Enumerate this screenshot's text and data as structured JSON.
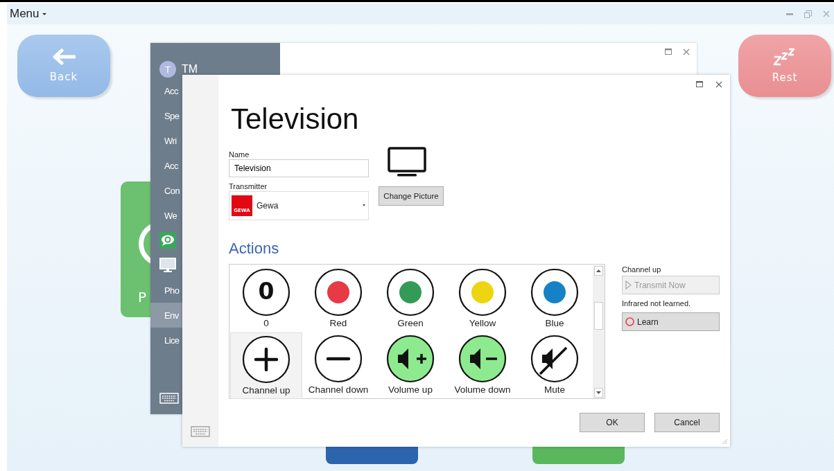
{
  "menu": {
    "label": "Menu"
  },
  "tiles": [
    {
      "label": "Back",
      "kind": "back"
    },
    {
      "label": "Rest",
      "kind": "rest"
    }
  ],
  "partial_tile": {
    "label": "P"
  },
  "settings_window": {
    "user": {
      "initial": "T",
      "name": "TM"
    },
    "items": [
      {
        "kind": "text",
        "label": "Acc",
        "selected": false
      },
      {
        "kind": "text",
        "label": "Spe",
        "selected": false
      },
      {
        "kind": "text",
        "label": "Wri",
        "selected": false
      },
      {
        "kind": "text",
        "label": "Acc",
        "selected": false
      },
      {
        "kind": "text",
        "label": "Con",
        "selected": false
      },
      {
        "kind": "text",
        "label": "We",
        "selected": false
      },
      {
        "kind": "chat",
        "selected": false
      },
      {
        "kind": "monitor",
        "selected": false
      },
      {
        "kind": "text",
        "label": "Pho",
        "selected": false
      },
      {
        "kind": "text",
        "label": "Env",
        "selected": true
      },
      {
        "kind": "text",
        "label": "Lice",
        "selected": false
      }
    ]
  },
  "dialog": {
    "title": "Television",
    "name_label": "Name",
    "name_value": "Television",
    "transmitter_label": "Transmitter",
    "transmitter": {
      "logo": "GEWA",
      "value": "Gewa"
    },
    "change_picture": "Change Picture",
    "actions_heading": "Actions",
    "actions": [
      {
        "label": "0",
        "kind": "digit",
        "glyph": "0",
        "selected": false
      },
      {
        "label": "Red",
        "kind": "dot",
        "color": "#e83a45",
        "selected": false
      },
      {
        "label": "Green",
        "kind": "dot",
        "color": "#339b58",
        "selected": false
      },
      {
        "label": "Yellow",
        "kind": "dot",
        "color": "#eed511",
        "selected": false
      },
      {
        "label": "Blue",
        "kind": "dot",
        "color": "#1682c6",
        "selected": false
      },
      {
        "label": "Channel up",
        "kind": "plus",
        "selected": true
      },
      {
        "label": "Channel down",
        "kind": "minus",
        "selected": false
      },
      {
        "label": "Volume up",
        "kind": "volume-up",
        "selected": false
      },
      {
        "label": "Volume down",
        "kind": "volume-down",
        "selected": false
      },
      {
        "label": "Mute",
        "kind": "mute",
        "selected": false
      }
    ],
    "detail": {
      "title": "Channel up",
      "transmit": "Transmit Now",
      "transmit_disabled": true,
      "status": "Infrared not learned.",
      "learn": "Learn"
    },
    "buttons": [
      "OK",
      "Cancel"
    ]
  }
}
